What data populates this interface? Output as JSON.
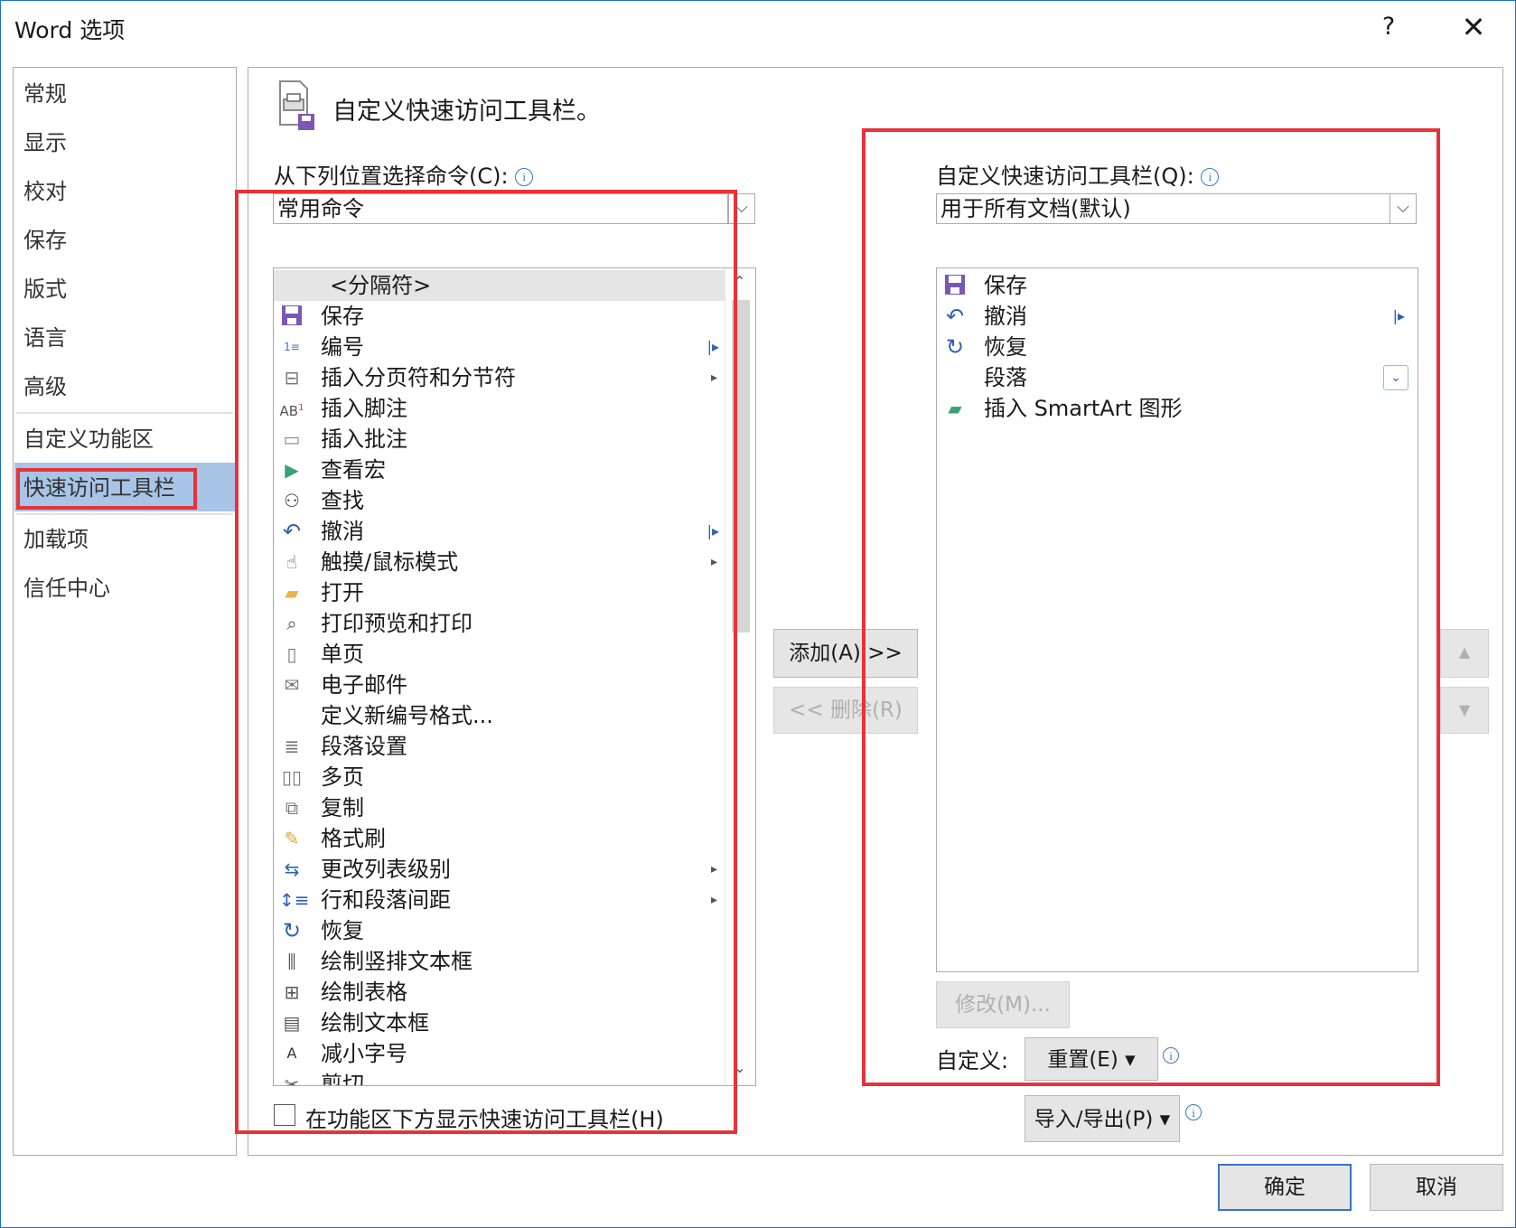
{
  "window": {
    "title": "Word 选项",
    "help": "?",
    "close": "✕"
  },
  "nav": {
    "items": [
      "常规",
      "显示",
      "校对",
      "保存",
      "版式",
      "语言",
      "高级",
      "自定义功能区",
      "快速访问工具栏",
      "加载项",
      "信任中心"
    ],
    "selected": "快速访问工具栏"
  },
  "header": {
    "title": "自定义快速访问工具栏。"
  },
  "left": {
    "label": "从下列位置选择命令(C):",
    "combo_value": "常用命令",
    "items": [
      {
        "label": "<分隔符>",
        "icon": ""
      },
      {
        "label": "保存",
        "icon": "save-icon"
      },
      {
        "label": "编号",
        "icon": "numbering-icon"
      },
      {
        "label": "插入分页符和分节符",
        "icon": "page-break-icon"
      },
      {
        "label": "插入脚注",
        "icon": "footnote-icon"
      },
      {
        "label": "插入批注",
        "icon": "comment-icon"
      },
      {
        "label": "查看宏",
        "icon": "macro-icon"
      },
      {
        "label": "查找",
        "icon": "binoculars-icon"
      },
      {
        "label": "撤消",
        "icon": "undo-icon"
      },
      {
        "label": "触摸/鼠标模式",
        "icon": "touch-icon"
      },
      {
        "label": "打开",
        "icon": "folder-icon"
      },
      {
        "label": "打印预览和打印",
        "icon": "print-preview-icon"
      },
      {
        "label": "单页",
        "icon": "page-icon"
      },
      {
        "label": "电子邮件",
        "icon": "email-icon"
      },
      {
        "label": "定义新编号格式...",
        "icon": ""
      },
      {
        "label": "段落设置",
        "icon": "paragraph-icon"
      },
      {
        "label": "多页",
        "icon": "multi-page-icon"
      },
      {
        "label": "复制",
        "icon": "copy-icon"
      },
      {
        "label": "格式刷",
        "icon": "format-painter-icon"
      },
      {
        "label": "更改列表级别",
        "icon": "list-level-icon"
      },
      {
        "label": "行和段落间距",
        "icon": "line-spacing-icon"
      },
      {
        "label": "恢复",
        "icon": "redo-icon"
      },
      {
        "label": "绘制竖排文本框",
        "icon": "vertical-textbox-icon"
      },
      {
        "label": "绘制表格",
        "icon": "draw-table-icon"
      },
      {
        "label": "绘制文本框",
        "icon": "textbox-icon"
      },
      {
        "label": "减小字号",
        "icon": "shrink-font-icon"
      },
      {
        "label": "剪切",
        "icon": "cut-icon"
      }
    ],
    "checkbox_label": "在功能区下方显示快速访问工具栏(H)"
  },
  "middle": {
    "add": "添加(A) >>",
    "remove": "<< 删除(R)"
  },
  "right": {
    "label": "自定义快速访问工具栏(Q):",
    "combo_value": "用于所有文档(默认)",
    "items": [
      {
        "label": "保存",
        "icon": "save-icon"
      },
      {
        "label": "撤消",
        "icon": "undo-icon"
      },
      {
        "label": "恢复",
        "icon": "redo-icon"
      },
      {
        "label": "段落",
        "icon": ""
      },
      {
        "label": "插入 SmartArt 图形",
        "icon": "smartart-icon"
      }
    ],
    "modify": "修改(M)...",
    "customize_label": "自定义:",
    "reset": "重置(E) ▾",
    "import_export": "导入/导出(P) ▾"
  },
  "footer": {
    "ok": "确定",
    "cancel": "取消"
  },
  "colors": {
    "highlight": "#e8323a",
    "selection": "#a8c4e6",
    "accent": "#1a74c9"
  }
}
